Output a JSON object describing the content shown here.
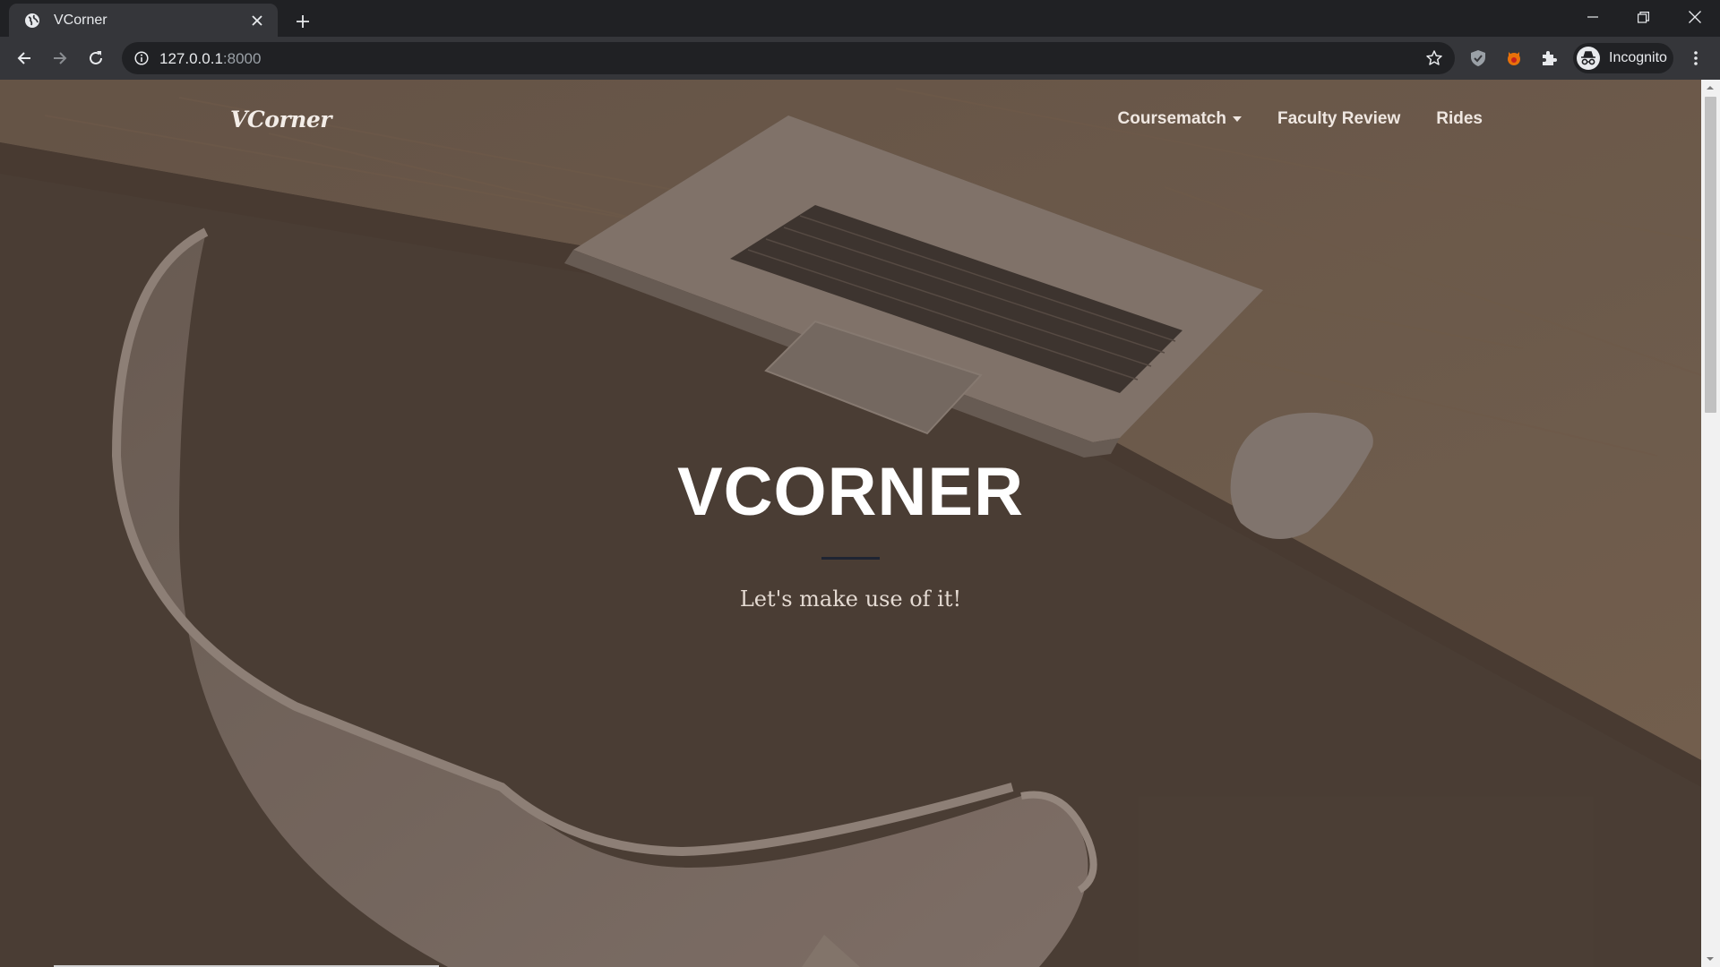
{
  "browser": {
    "tab_title": "VCorner",
    "url_host": "127.0.0.1",
    "url_port": ":8000",
    "profile_label": "Incognito"
  },
  "site": {
    "brand": "VCorner",
    "nav": {
      "coursematch": "Coursematch",
      "faculty_review": "Faculty Review",
      "rides": "Rides"
    }
  },
  "hero": {
    "title": "VCORNER",
    "subtitle": "Let's make use of it!"
  },
  "colors": {
    "divider": "#1f2432",
    "chrome_dark": "#202124",
    "chrome_toolbar": "#35363a"
  },
  "scrollbar": {
    "visible_fraction": 0.37
  }
}
